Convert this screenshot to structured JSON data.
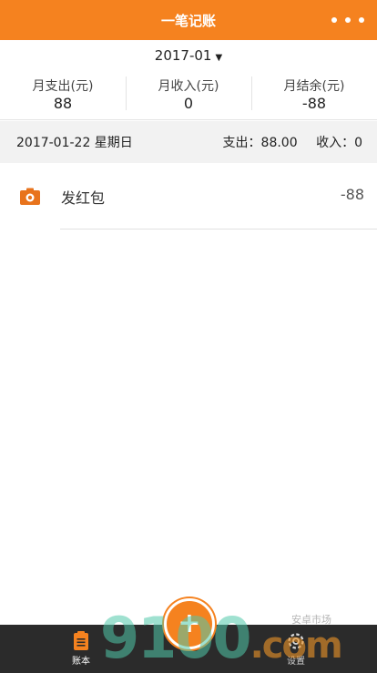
{
  "header": {
    "title": "一笔记账"
  },
  "month": {
    "label": "2017-01",
    "arrow": "▼"
  },
  "summary": {
    "expense_label": "月支出(元)",
    "expense_value": "88",
    "income_label": "月收入(元)",
    "income_value": "0",
    "balance_label": "月结余(元)",
    "balance_value": "-88"
  },
  "day": {
    "date": "2017-01-22 星期日",
    "expense": "支出：88.00",
    "income": "收入：0"
  },
  "records": [
    {
      "icon": "red-envelope-icon",
      "name": "发红包",
      "amount": "-88"
    }
  ],
  "tabbar": {
    "ledger_label": "账本",
    "settings_label": "设置",
    "add_glyph": "+"
  },
  "watermark": {
    "main": "9100",
    "tail": ".com",
    "small": "安卓市场"
  },
  "colors": {
    "accent": "#f5821f",
    "tabbar": "#2b2b2b",
    "day_header_bg": "#f2f2f2"
  }
}
